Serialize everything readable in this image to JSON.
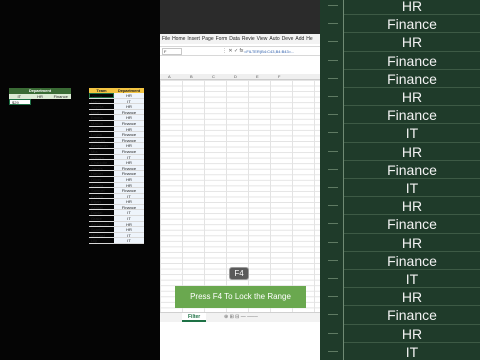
{
  "menu": [
    "File",
    "Home",
    "Insert",
    "Page",
    "Form",
    "Data",
    "Revie",
    "View",
    "Auto",
    "Deve",
    "Add",
    "He"
  ],
  "formula_bar": {
    "name_box": "F",
    "icons": "⋮  ✕  ✓  fx",
    "formula": "=FILTER(B4:C43,B4:B43=..."
  },
  "columns": [
    "A",
    "B",
    "C",
    "D",
    "E",
    "F"
  ],
  "criteria": {
    "header": "Department",
    "options": [
      "IT",
      "HR",
      "Finance"
    ],
    "value": "$29"
  },
  "team_table": {
    "headers": [
      "Team",
      "Department"
    ],
    "rows": [
      [
        "Olivia",
        "HR"
      ],
      [
        "Liam",
        "IT"
      ],
      [
        "Sophia",
        "HR"
      ],
      [
        "Noah",
        "Finance"
      ],
      [
        "Emma",
        "HR"
      ],
      [
        "Mason",
        "Finance"
      ],
      [
        "Ava",
        "HR"
      ],
      [
        "Logan",
        "Finance"
      ],
      [
        "Isabella",
        "Finance"
      ],
      [
        "Benjamin",
        "HR"
      ],
      [
        "Mia",
        "Finance"
      ],
      [
        "William",
        "IT"
      ],
      [
        "Charlotte",
        "HR"
      ],
      [
        "James",
        "Finance"
      ],
      [
        "Harper",
        "Finance"
      ],
      [
        "Oliver",
        "HR"
      ],
      [
        "Amelia",
        "HR"
      ],
      [
        "Samuel",
        "Finance"
      ],
      [
        "Evelyn",
        "IT"
      ],
      [
        "Elijah",
        "HR"
      ],
      [
        "Abigail",
        "Finance"
      ],
      [
        "Daniel",
        "IT"
      ],
      [
        "Grace",
        "IT"
      ],
      [
        "Alexander",
        "HR"
      ],
      [
        "Scarlett",
        "HR"
      ],
      [
        "Michael",
        "IT"
      ],
      [
        "Lily",
        "IT"
      ]
    ]
  },
  "key_badge": "F4",
  "caption": "Press F4 To Lock the Range",
  "sheet_tab": "Filter",
  "tab_icons": "⊕  ⊞  ⊟  —  ───",
  "background_words": [
    "HR",
    "Finance",
    "HR",
    "Finance",
    "Finance",
    "HR",
    "Finance",
    "IT",
    "HR",
    "Finance",
    "IT",
    "HR",
    "Finance",
    "HR",
    "Finance",
    "IT",
    "HR",
    "Finance",
    "HR",
    "IT"
  ],
  "colors": {
    "criteria_header": "#3a6b35",
    "team_header": "#f4c542",
    "caption_bg": "#6aa84f",
    "right_bg": "#1f3b2a"
  }
}
